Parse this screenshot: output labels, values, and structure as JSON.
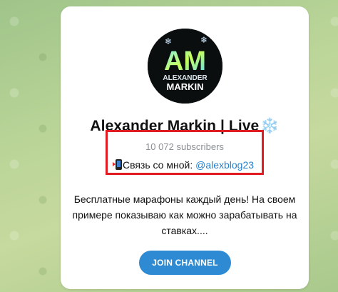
{
  "channel": {
    "title": "Alexander Markin | Live",
    "title_emoji": "❄️",
    "avatar_text_top": "AM",
    "avatar_text_line1": "ALEXANDER",
    "avatar_text_line2": "MARKIN",
    "subscribers": "10 072 subscribers",
    "contact_label": "Связь со мной: ",
    "contact_handle": "@alexblog23",
    "description": "Бесплатные марафоны каждый день! На своем примере показываю как можно зарабатывать на ставках....",
    "join_label": "JOIN CHANNEL"
  },
  "colors": {
    "accent": "#2e8ad2",
    "highlight_border": "#e01b22",
    "link": "#2481cc"
  }
}
